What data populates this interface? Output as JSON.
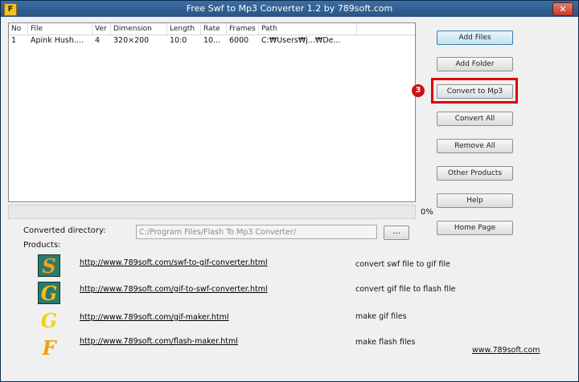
{
  "window": {
    "title": "Free Swf to Mp3 Converter 1.2 by 789soft.com",
    "close_glyph": "✕"
  },
  "list": {
    "columns": [
      "No",
      "File",
      "Ver",
      "Dimension",
      "Length",
      "Rate",
      "Frames",
      "Path"
    ],
    "rows": [
      [
        "1",
        "Apink Hush....",
        "4",
        "320×200",
        "10:0",
        "10...",
        "6000",
        "C:₩Users₩j...₩De..."
      ]
    ]
  },
  "progress": {
    "percent_text": "0%",
    "value": 0
  },
  "buttons": {
    "add_files": "Add Files",
    "add_folder": "Add Folder",
    "convert_to_mp3": "Convert to Mp3",
    "convert_all": "Convert All",
    "remove_all": "Remove All",
    "other_products": "Other Products",
    "help": "Help",
    "home_page": "Home Page"
  },
  "annotation": {
    "badge": "3",
    "color": "#e00000"
  },
  "output": {
    "label": "Converted directory:",
    "value": "C:/Program Files/Flash To Mp3 Converter/",
    "browse_label": "..."
  },
  "products": {
    "label": "Products:",
    "items": [
      {
        "icon": "S",
        "link": "http://www.789soft.com/swf-to-gif-converter.html",
        "desc": "convert swf file to gif file"
      },
      {
        "icon": "G",
        "link": "http://www.789soft.com/gif-to-swf-converter.html",
        "desc": "convert gif file to flash file"
      },
      {
        "icon": "G",
        "link": "http://www.789soft.com/gif-maker.html",
        "desc": "make gif files"
      },
      {
        "icon": "F",
        "link": "http://www.789soft.com/flash-maker.html",
        "desc": "make flash files"
      }
    ]
  },
  "footer": {
    "site": "www.789soft.com"
  },
  "colors": {
    "title_bar": "#2a5383",
    "primary_button": "#c4e3f4",
    "highlight": "#e00000"
  }
}
